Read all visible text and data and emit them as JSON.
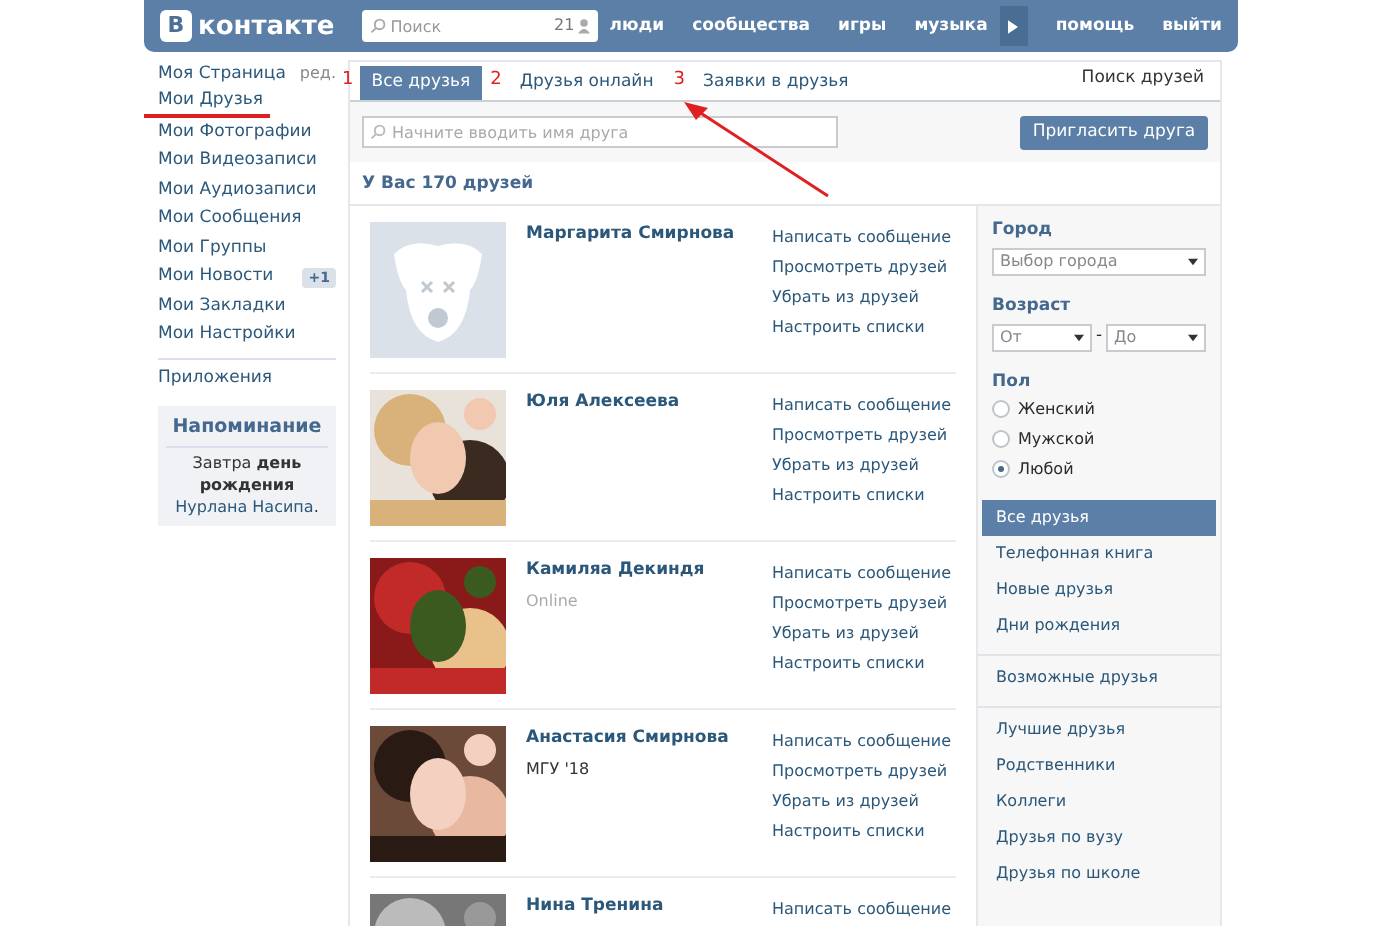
{
  "header": {
    "logo_badge": "В",
    "logo_text": "контакте",
    "search": {
      "placeholder": "Поиск",
      "count": "21"
    },
    "nav": [
      "люди",
      "сообщества",
      "игры",
      "музыка"
    ],
    "nav_right": [
      "помощь",
      "выйти"
    ]
  },
  "sidebar": {
    "items": [
      {
        "label": "Моя Страница",
        "edit": "ред.",
        "annotated": false
      },
      {
        "label": "Мои Друзья",
        "annotated": true
      },
      {
        "label": "Мои Фотографии",
        "annotated": false
      },
      {
        "label": "Мои Видеозаписи",
        "annotated": false
      },
      {
        "label": "Мои Аудиозаписи",
        "annotated": false
      },
      {
        "label": "Мои Сообщения",
        "annotated": false
      },
      {
        "label": "Мои Группы",
        "annotated": false
      },
      {
        "label": "Мои Новости",
        "badge": "+1",
        "annotated": false
      },
      {
        "label": "Мои Закладки",
        "annotated": false
      },
      {
        "label": "Мои Настройки",
        "annotated": false
      }
    ],
    "apps": "Приложения",
    "reminder": {
      "title": "Напоминание",
      "text": "Завтра **день рождения**",
      "link": "Нурлана Насипа",
      "end": "."
    }
  },
  "tabs": [
    {
      "number": "1",
      "label": "Все друзья",
      "selected": true
    },
    {
      "number": "2",
      "label": "Друзья онлайн",
      "selected": false
    },
    {
      "number": "3",
      "label": "Заявки в друзья",
      "selected": false
    }
  ],
  "find_friends": "Поиск друзей",
  "friend_search": {
    "placeholder": "Начните вводить имя друга"
  },
  "invite_button": "Пригласить друга",
  "count": "У Вас 170 друзей",
  "friends": [
    {
      "name": "Маргарита Смирнова",
      "kind": "deactivated",
      "actions": [
        "Написать сообщение",
        "Просмотреть друзей",
        "Убрать из друзей",
        "Настроить списки"
      ]
    },
    {
      "name": "Юля Алексеева",
      "kind": "picture",
      "actions": [
        "Написать сообщение",
        "Просмотреть друзей",
        "Убрать из друзей",
        "Настроить списки"
      ]
    },
    {
      "name": "Камиляа Декиндя",
      "status": "Online",
      "kind": "picture",
      "actions": [
        "Написать сообщение",
        "Просмотреть друзей",
        "Убрать из друзей",
        "Настроить списки"
      ]
    },
    {
      "name": "Анастасия Смирнова",
      "info": "МГУ '18",
      "kind": "picture",
      "actions": [
        "Написать сообщение",
        "Просмотреть друзей",
        "Убрать из друзей",
        "Настроить списки"
      ]
    },
    {
      "name": "Нина Тренина",
      "kind": "picture",
      "actions": [
        "Написать сообщение"
      ]
    }
  ],
  "filters": {
    "city_label": "Город",
    "city": "Выбор города",
    "age_label": "Возраст",
    "age_from": "От",
    "age_sep": "-",
    "age_to": "До",
    "gender_label": "Пол",
    "genders": [
      {
        "label": "Женский",
        "selected": false
      },
      {
        "label": "Мужской",
        "selected": false
      },
      {
        "label": "Любой",
        "selected": true
      }
    ],
    "lists": [
      [
        {
          "label": "Все друзья",
          "selected": true
        },
        {
          "label": "Телефонная книга",
          "selected": false
        },
        {
          "label": "Новые друзья",
          "selected": false
        },
        {
          "label": "Дни рождения",
          "selected": false
        }
      ],
      [
        {
          "label": "Возможные друзья",
          "selected": false
        }
      ],
      [
        {
          "label": "Лучшие друзья",
          "selected": false
        },
        {
          "label": "Родственники",
          "selected": false
        },
        {
          "label": "Коллеги",
          "selected": false
        },
        {
          "label": "Друзья по вузу",
          "selected": false
        },
        {
          "label": "Друзья по школе",
          "selected": false
        }
      ]
    ]
  }
}
